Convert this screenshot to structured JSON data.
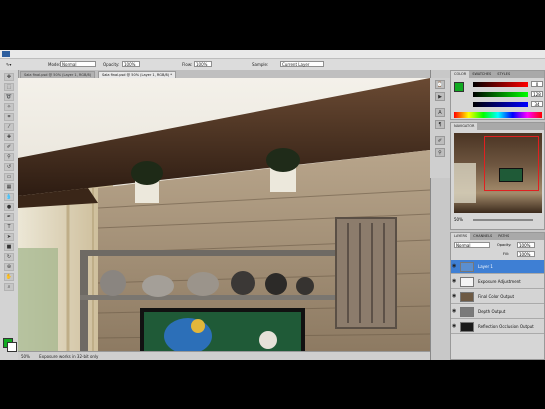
{
  "app": {
    "tool_options": {
      "mode_label": "Mode:",
      "mode_value": "Normal",
      "opacity_label": "Opacity:",
      "opacity_value": "100%",
      "flow_label": "Flow:",
      "flow_value": "100%",
      "sample_label": "Sample:",
      "sample_value": "Current Layer"
    },
    "document_tabs": [
      {
        "label": "Sala final.psd @ 50% (Layer 1, RGB/8)",
        "active": false
      },
      {
        "label": "Sala final.psd @ 50% (Layer 1, RGB/8) *",
        "active": true
      }
    ],
    "status_bar": {
      "zoom": "50%",
      "info": "Exposure works in 32-bit only"
    },
    "color_panel": {
      "tabs": [
        "COLOR",
        "SWATCHES",
        "STYLES"
      ],
      "r": "0",
      "g": "128",
      "b": "34",
      "fg_color": "#11aa22"
    },
    "navigator_panel": {
      "tab": "NAVIGATOR",
      "zoom": "50%"
    },
    "layers_panel": {
      "tabs": [
        "LAYERS",
        "CHANNELS",
        "PATHS"
      ],
      "blend_mode": "Normal",
      "opacity_label": "Opacity:",
      "opacity_value": "100%",
      "fill_label": "Fill:",
      "fill_value": "100%",
      "layers": [
        {
          "name": "Layer 1",
          "selected": true
        },
        {
          "name": "Exposure Adjustment",
          "selected": false
        },
        {
          "name": "Final Color Output",
          "selected": false
        },
        {
          "name": "Depth Output",
          "selected": false
        },
        {
          "name": "Reflection Occlusion Output",
          "selected": false
        }
      ]
    },
    "tools": [
      "move-tool",
      "marquee-tool",
      "lasso-tool",
      "quick-select-tool",
      "crop-tool",
      "eyedropper-tool",
      "healing-tool",
      "brush-tool",
      "clone-stamp-tool",
      "history-brush-tool",
      "eraser-tool",
      "gradient-tool",
      "blur-tool",
      "dodge-tool",
      "pen-tool",
      "type-tool",
      "path-select-tool",
      "shape-tool",
      "3d-rotate-tool",
      "3d-orbit-tool",
      "hand-tool",
      "zoom-tool"
    ]
  }
}
